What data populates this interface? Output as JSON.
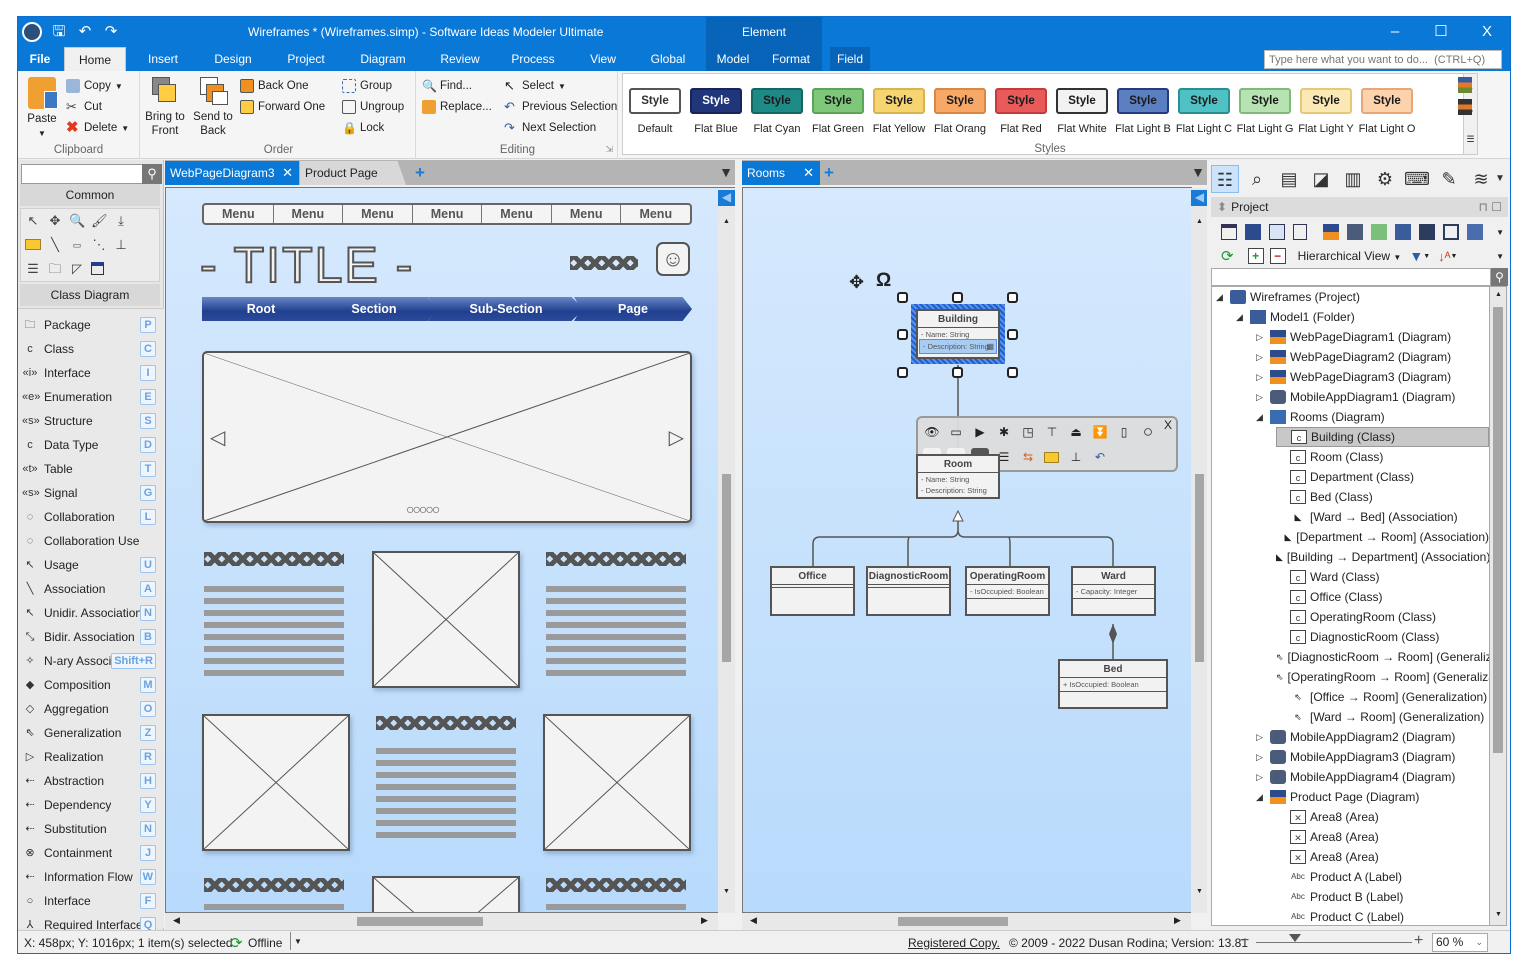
{
  "window": {
    "title": "Wireframes *  (Wireframes.simp) - Software Ideas Modeler Ultimate",
    "context_tab_group": "Element",
    "controls": {
      "minimize": "–",
      "maximize": "☐",
      "close": "X"
    }
  },
  "ribbon_tabs": [
    {
      "label": "File"
    },
    {
      "label": "Home"
    },
    {
      "label": "Insert"
    },
    {
      "label": "Design"
    },
    {
      "label": "Project"
    },
    {
      "label": "Diagram"
    },
    {
      "label": "Review"
    },
    {
      "label": "Process"
    },
    {
      "label": "View"
    },
    {
      "label": "Global"
    },
    {
      "label": "Model"
    },
    {
      "label": "Format"
    },
    {
      "label": "Field"
    }
  ],
  "search": {
    "placeholder": "Type here what you want to do...  (CTRL+Q)"
  },
  "ribbon": {
    "clipboard": {
      "label": "Clipboard",
      "paste": "Paste",
      "copy": "Copy",
      "cut": "Cut",
      "delete": "Delete"
    },
    "order": {
      "label": "Order",
      "bring_front_1": "Bring to",
      "bring_front_2": "Front",
      "send_back_1": "Send to",
      "send_back_2": "Back",
      "back_one": "Back One",
      "forward_one": "Forward One",
      "group": "Group",
      "ungroup": "Ungroup",
      "lock": "Lock"
    },
    "editing": {
      "label": "Editing",
      "find": "Find...",
      "replace": "Replace...",
      "select": "Select",
      "previous_selection": "Previous Selection",
      "next_selection": "Next Selection"
    },
    "styles": {
      "label": "Styles",
      "items": [
        {
          "text": "Style",
          "name": "Default",
          "bg": "#ffffff",
          "border": "#555555",
          "color": "#333333"
        },
        {
          "text": "Style",
          "name": "Flat Blue",
          "bg": "#21357a",
          "border": "#16245a",
          "color": "#ffffff"
        },
        {
          "text": "Style",
          "name": "Flat Cyan",
          "bg": "#1e8a86",
          "border": "#156663",
          "color": "#1a1a1a"
        },
        {
          "text": "Style",
          "name": "Flat Green",
          "bg": "#7ec77a",
          "border": "#5aa656",
          "color": "#1a1a1a"
        },
        {
          "text": "Style",
          "name": "Flat Yellow",
          "bg": "#f7d472",
          "border": "#d9b44e",
          "color": "#1a1a1a"
        },
        {
          "text": "Style",
          "name": "Flat Orang",
          "bg": "#f7a766",
          "border": "#d98742",
          "color": "#1a1a1a"
        },
        {
          "text": "Style",
          "name": "Flat Red",
          "bg": "#e95b5b",
          "border": "#c43c3c",
          "color": "#1a1a1a"
        },
        {
          "text": "Style",
          "name": "Flat White",
          "bg": "#f2f2f2",
          "border": "#333333",
          "color": "#1a1a1a"
        },
        {
          "text": "Style",
          "name": "Flat Light B",
          "bg": "#5b7fc0",
          "border": "#243c7c",
          "color": "#1a1a1a"
        },
        {
          "text": "Style",
          "name": "Flat Light C",
          "bg": "#4fc1c4",
          "border": "#2b8e91",
          "color": "#1a1a1a"
        },
        {
          "text": "Style",
          "name": "Flat Light G",
          "bg": "#b7e2b2",
          "border": "#80b97a",
          "color": "#1a1a1a"
        },
        {
          "text": "Style",
          "name": "Flat Light Y",
          "bg": "#fbe9b5",
          "border": "#e8c878",
          "color": "#1a1a1a"
        },
        {
          "text": "Style",
          "name": "Flat Light O",
          "bg": "#fcd3ad",
          "border": "#e8a778",
          "color": "#1a1a1a"
        }
      ]
    }
  },
  "toolbox": {
    "common_header": "Common",
    "class_header": "Class Diagram",
    "items": [
      {
        "label": "Package",
        "key": "P",
        "icon": "🗀"
      },
      {
        "label": "Class",
        "key": "C",
        "icon": "c"
      },
      {
        "label": "Interface",
        "key": "I",
        "icon": "«i»"
      },
      {
        "label": "Enumeration",
        "key": "E",
        "icon": "«e»"
      },
      {
        "label": "Structure",
        "key": "S",
        "icon": "«s»"
      },
      {
        "label": "Data Type",
        "key": "D",
        "icon": "c"
      },
      {
        "label": "Table",
        "key": "T",
        "icon": "«t»"
      },
      {
        "label": "Signal",
        "key": "G",
        "icon": "«s»"
      },
      {
        "label": "Collaboration",
        "key": "L",
        "icon": "◌"
      },
      {
        "label": "Collaboration Use",
        "key": "",
        "icon": "◌"
      },
      {
        "label": "Usage",
        "key": "U",
        "icon": "↖"
      },
      {
        "label": "Association",
        "key": "A",
        "icon": "╲"
      },
      {
        "label": "Unidir. Association",
        "key": "N",
        "icon": "↖"
      },
      {
        "label": "Bidir. Association",
        "key": "B",
        "icon": "⤡"
      },
      {
        "label": "N-ary Association",
        "key": "Shift+R",
        "icon": "✧"
      },
      {
        "label": "Composition",
        "key": "M",
        "icon": "◆"
      },
      {
        "label": "Aggregation",
        "key": "O",
        "icon": "◇"
      },
      {
        "label": "Generalization",
        "key": "Z",
        "icon": "⇖"
      },
      {
        "label": "Realization",
        "key": "R",
        "icon": "▷"
      },
      {
        "label": "Abstraction",
        "key": "H",
        "icon": "⇠"
      },
      {
        "label": "Dependency",
        "key": "Y",
        "icon": "⇠"
      },
      {
        "label": "Substitution",
        "key": "N",
        "icon": "⇠"
      },
      {
        "label": "Containment",
        "key": "J",
        "icon": "⊗"
      },
      {
        "label": "Information Flow",
        "key": "W",
        "icon": "⇠"
      },
      {
        "label": "Interface",
        "key": "F",
        "icon": "○"
      },
      {
        "label": "Required  Interface",
        "key": "Q",
        "icon": "⅄"
      }
    ]
  },
  "left_doc": {
    "tabs": [
      {
        "label": "WebPageDiagram3",
        "close": "✕"
      },
      {
        "label": "Product Page"
      }
    ],
    "add_tab": "+",
    "menu_items": [
      "Menu",
      "Menu",
      "Menu",
      "Menu",
      "Menu",
      "Menu",
      "Menu"
    ],
    "title_text": "- TITLE -",
    "breadcrumb": [
      "Root",
      "Section",
      "Sub-Section",
      "Page"
    ]
  },
  "right_doc": {
    "tabs": [
      {
        "label": "Rooms",
        "close": "✕"
      }
    ],
    "add_tab": "+",
    "classes": {
      "building": {
        "name": "Building",
        "attrs": [
          "- Name: String",
          "- Description: String"
        ]
      },
      "room": {
        "name": "Room",
        "attrs": [
          "- Name: String",
          "- Description: String"
        ]
      },
      "office": {
        "name": "Office"
      },
      "diagnostic": {
        "name": "DiagnosticRoom"
      },
      "operating": {
        "name": "OperatingRoom",
        "attrs": [
          "- IsOccupied: Boolean"
        ]
      },
      "ward": {
        "name": "Ward",
        "attrs": [
          "- Capacity: Integer"
        ]
      },
      "bed": {
        "name": "Bed",
        "attrs": [
          "+ IsOccupied: Boolean"
        ]
      }
    },
    "floatbar_close": "X"
  },
  "project_panel": {
    "title": "Project",
    "view_mode": "Hierarchical View",
    "tree": [
      {
        "label": "Wireframes (Project)",
        "level": 0,
        "exp": "◢",
        "icon": "project"
      },
      {
        "label": "Model1 (Folder)",
        "level": 1,
        "exp": "◢",
        "icon": "folder"
      },
      {
        "label": "WebPageDiagram1 (Diagram)",
        "level": 2,
        "exp": "▷",
        "icon": "web"
      },
      {
        "label": "WebPageDiagram2 (Diagram)",
        "level": 2,
        "exp": "▷",
        "icon": "web"
      },
      {
        "label": "WebPageDiagram3 (Diagram)",
        "level": 2,
        "exp": "▷",
        "icon": "web"
      },
      {
        "label": "MobileAppDiagram1 (Diagram)",
        "level": 2,
        "exp": "▷",
        "icon": "mobile"
      },
      {
        "label": "Rooms (Diagram)",
        "level": 2,
        "exp": "◢",
        "icon": "class-diagram"
      },
      {
        "label": "Building (Class)",
        "level": 3,
        "exp": "",
        "icon": "class",
        "selected": true
      },
      {
        "label": "Room (Class)",
        "level": 3,
        "exp": "",
        "icon": "class"
      },
      {
        "label": "Department (Class)",
        "level": 3,
        "exp": "",
        "icon": "class"
      },
      {
        "label": "Bed (Class)",
        "level": 3,
        "exp": "",
        "icon": "class"
      },
      {
        "label": "[Ward → Bed] (Association)",
        "level": 3,
        "exp": "",
        "icon": "composition"
      },
      {
        "label": "[Department → Room] (Association)",
        "level": 3,
        "exp": "",
        "icon": "composition"
      },
      {
        "label": "[Building → Department] (Association)",
        "level": 3,
        "exp": "",
        "icon": "composition"
      },
      {
        "label": "Ward (Class)",
        "level": 3,
        "exp": "",
        "icon": "class"
      },
      {
        "label": "Office (Class)",
        "level": 3,
        "exp": "",
        "icon": "class"
      },
      {
        "label": "OperatingRoom (Class)",
        "level": 3,
        "exp": "",
        "icon": "class"
      },
      {
        "label": "DiagnosticRoom (Class)",
        "level": 3,
        "exp": "",
        "icon": "class"
      },
      {
        "label": "[DiagnosticRoom → Room] (Generalization)",
        "level": 3,
        "exp": "",
        "icon": "generalization"
      },
      {
        "label": "[OperatingRoom → Room] (Generalization)",
        "level": 3,
        "exp": "",
        "icon": "generalization"
      },
      {
        "label": "[Office → Room] (Generalization)",
        "level": 3,
        "exp": "",
        "icon": "generalization"
      },
      {
        "label": "[Ward → Room] (Generalization)",
        "level": 3,
        "exp": "",
        "icon": "generalization"
      },
      {
        "label": "MobileAppDiagram2 (Diagram)",
        "level": 2,
        "exp": "▷",
        "icon": "mobile"
      },
      {
        "label": "MobileAppDiagram3 (Diagram)",
        "level": 2,
        "exp": "▷",
        "icon": "mobile"
      },
      {
        "label": "MobileAppDiagram4 (Diagram)",
        "level": 2,
        "exp": "▷",
        "icon": "mobile"
      },
      {
        "label": "Product Page (Diagram)",
        "level": 2,
        "exp": "◢",
        "icon": "web"
      },
      {
        "label": "Area8 (Area)",
        "level": 3,
        "exp": "",
        "icon": "area"
      },
      {
        "label": "Area8 (Area)",
        "level": 3,
        "exp": "",
        "icon": "area"
      },
      {
        "label": "Area8 (Area)",
        "level": 3,
        "exp": "",
        "icon": "area"
      },
      {
        "label": "Product A (Label)",
        "level": 3,
        "exp": "",
        "icon": "label"
      },
      {
        "label": "Product B (Label)",
        "level": 3,
        "exp": "",
        "icon": "label"
      },
      {
        "label": "Product C (Label)",
        "level": 3,
        "exp": "",
        "icon": "label"
      }
    ]
  },
  "status": {
    "coords": "X: 458px; Y: 1016px; 1 item(s) selected",
    "connection": "Offline",
    "registered": "Registered Copy.",
    "copyright": "© 2009 - 2022 Dusan Rodina; Version: 13.81",
    "zoom": "60 %",
    "zoom_percent": 60
  }
}
